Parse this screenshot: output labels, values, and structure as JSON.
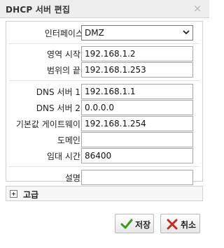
{
  "dialog": {
    "title": "DHCP 서버 편집",
    "close_glyph": "×"
  },
  "form": {
    "interface_label": "인터페이스",
    "interface_value": "DMZ",
    "range_start_label": "영역 시작:",
    "range_start_value": "192.168.1.2",
    "range_end_label": "범위의 끝:",
    "range_end_value": "192.168.1.253",
    "dns1_label": "DNS 서버 1:",
    "dns1_value": "192.168.1.1",
    "dns2_label": "DNS 서버 2:",
    "dns2_value": "0.0.0.0",
    "gateway_label": "기본값 게이트웨이:",
    "gateway_value": "192.168.1.254",
    "domain_label": "도메인:",
    "domain_value": "",
    "lease_label": "임대 시간:",
    "lease_value": "86400",
    "description_label": "설명:",
    "description_value": ""
  },
  "advanced": {
    "label": "고급"
  },
  "buttons": {
    "save_label": "저장",
    "cancel_label": "취소"
  },
  "icons": {
    "close": "close-icon",
    "expand": "plus-icon",
    "save": "checkmark-icon",
    "cancel": "x-icon",
    "dropdown": "chevron-down-icon"
  },
  "colors": {
    "save_check": "#3a9a1f",
    "cancel_x": "#c62a1c"
  }
}
